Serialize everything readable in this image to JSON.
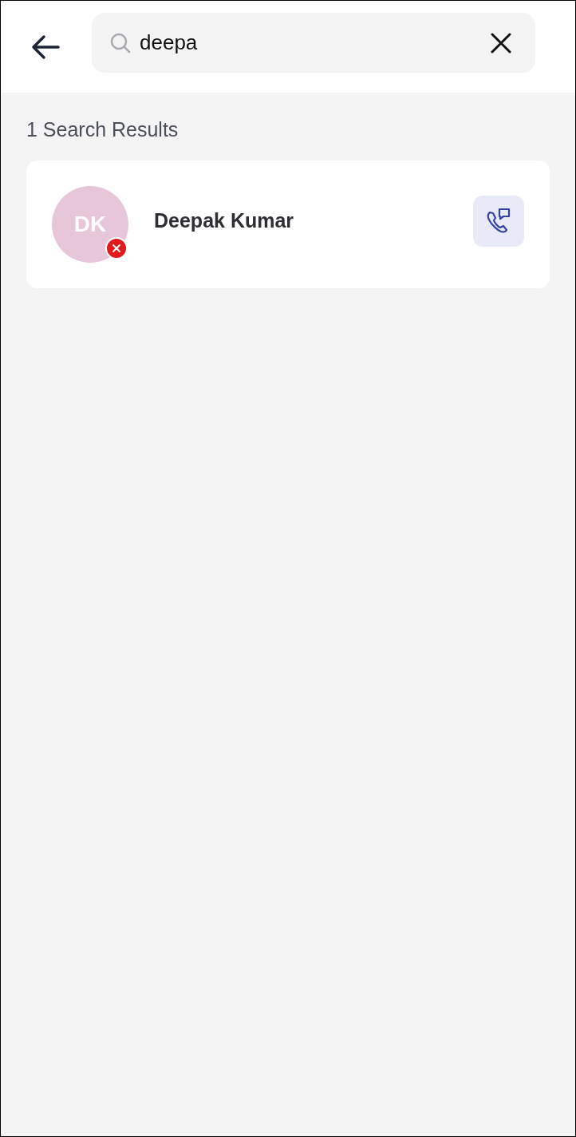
{
  "search": {
    "value": "deepa"
  },
  "results_heading": "1 Search Results",
  "results": [
    {
      "initials": "DK",
      "name": "Deepak Kumar",
      "available": false
    }
  ]
}
